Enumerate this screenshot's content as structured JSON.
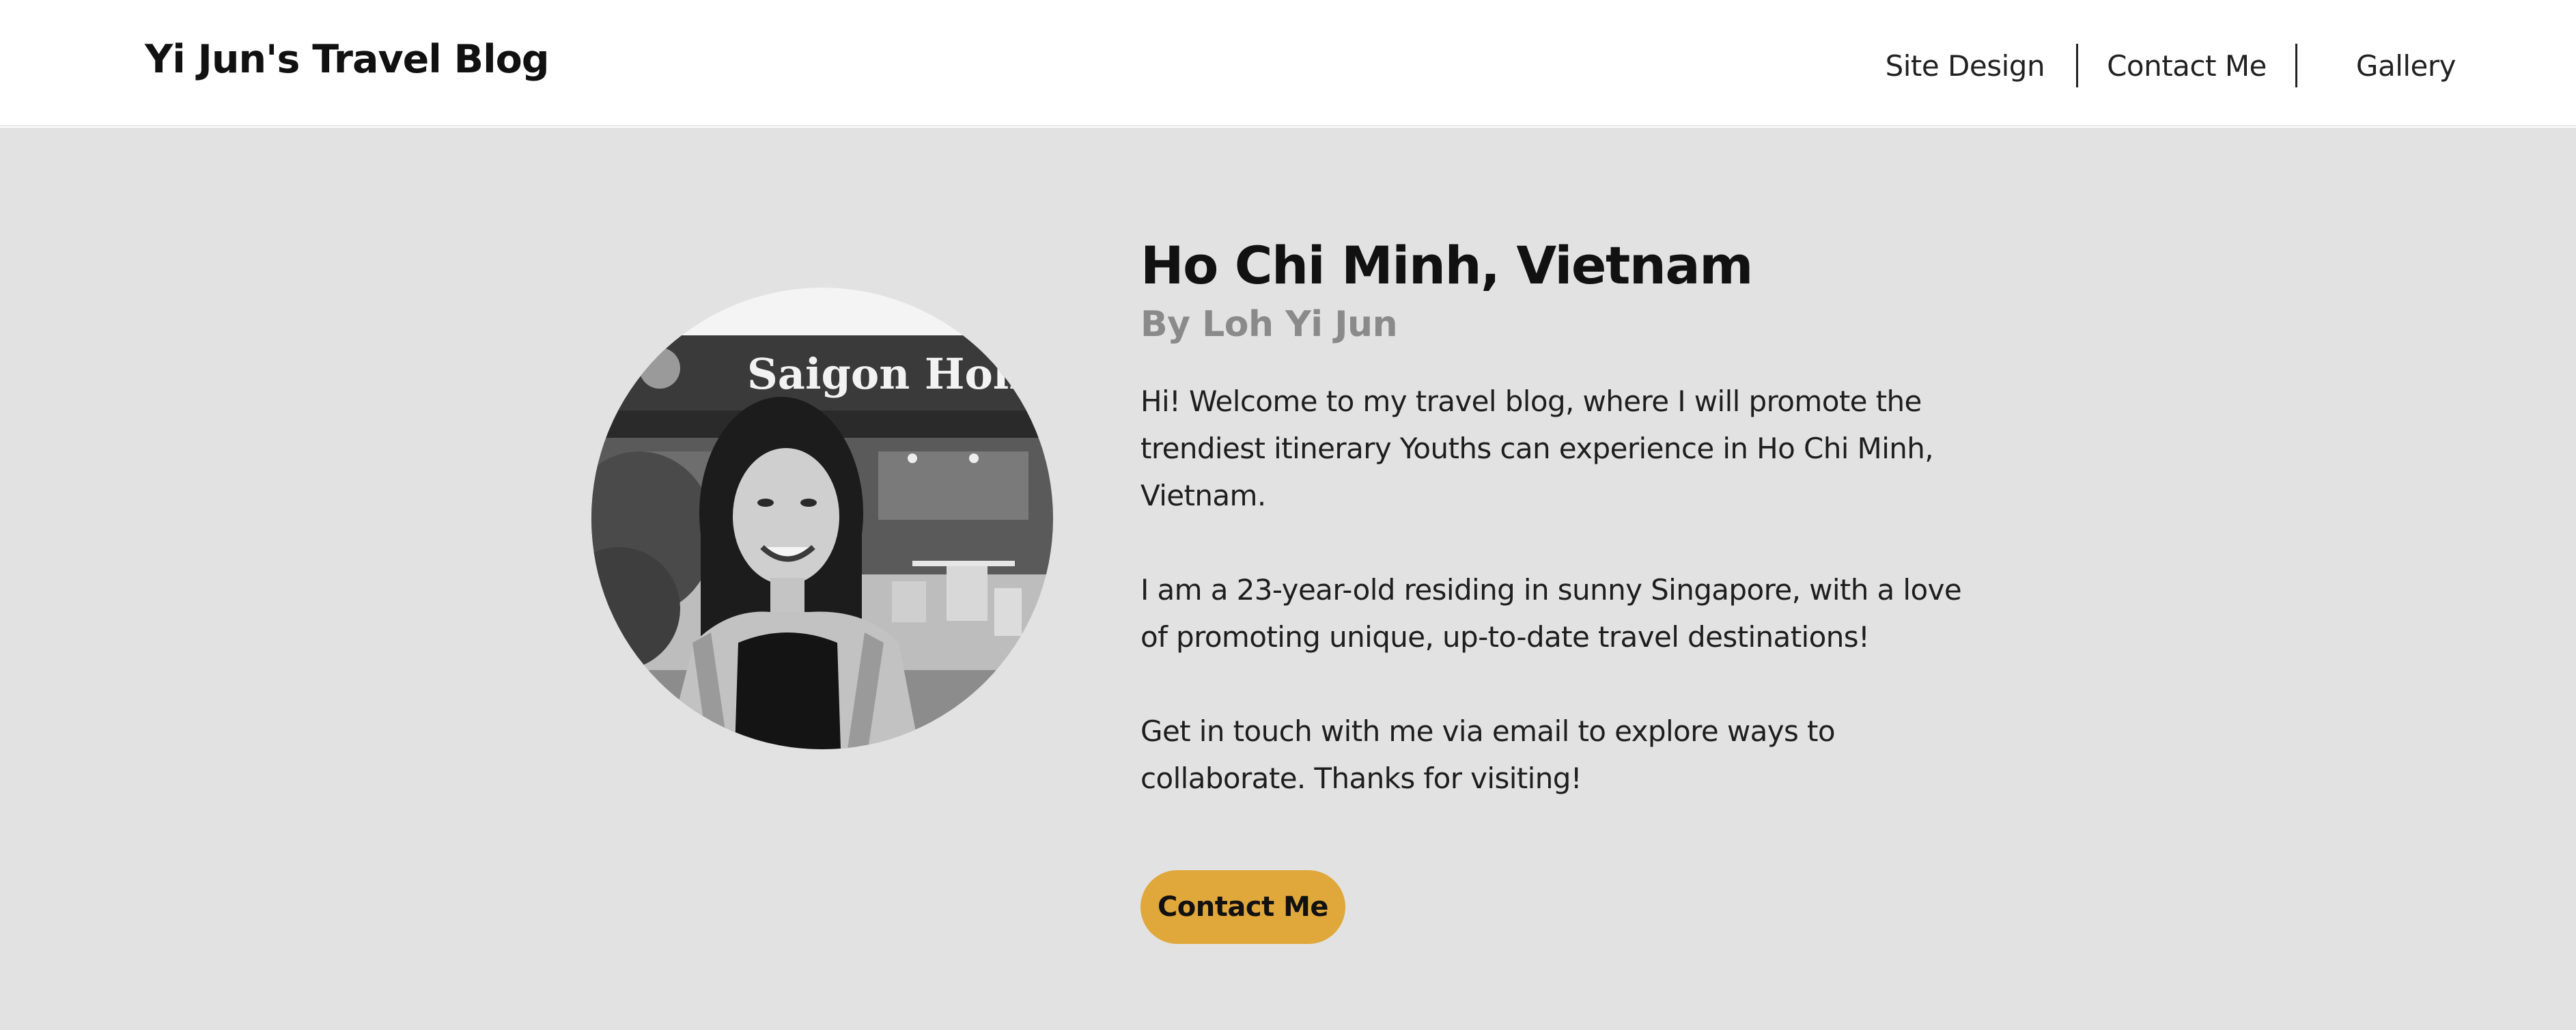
{
  "header": {
    "site_title": "Yi Jun's Travel Blog",
    "nav": [
      {
        "label": "Site Design"
      },
      {
        "label": "Contact Me"
      },
      {
        "label": "Gallery"
      }
    ]
  },
  "hero": {
    "title": "Ho Chi Minh, Vietnam",
    "byline": "By Loh Yi Jun",
    "paragraphs": [
      "Hi! Welcome to my travel blog, where I will promote the trendiest itinerary Youths can experience in Ho Chi Minh, Vietnam.",
      "I am a 23-year-old residing in sunny Singapore, with a love of promoting unique, up-to-date travel destinations!",
      "Get in touch with me via email to explore ways to collaborate. Thanks for visiting!"
    ],
    "cta_label": "Contact Me",
    "photo_sign_text": "Saigon Holiday"
  },
  "colors": {
    "hero_background": "#e2e2e2",
    "cta_background": "#e0a73a",
    "byline": "#8a8a8a"
  }
}
